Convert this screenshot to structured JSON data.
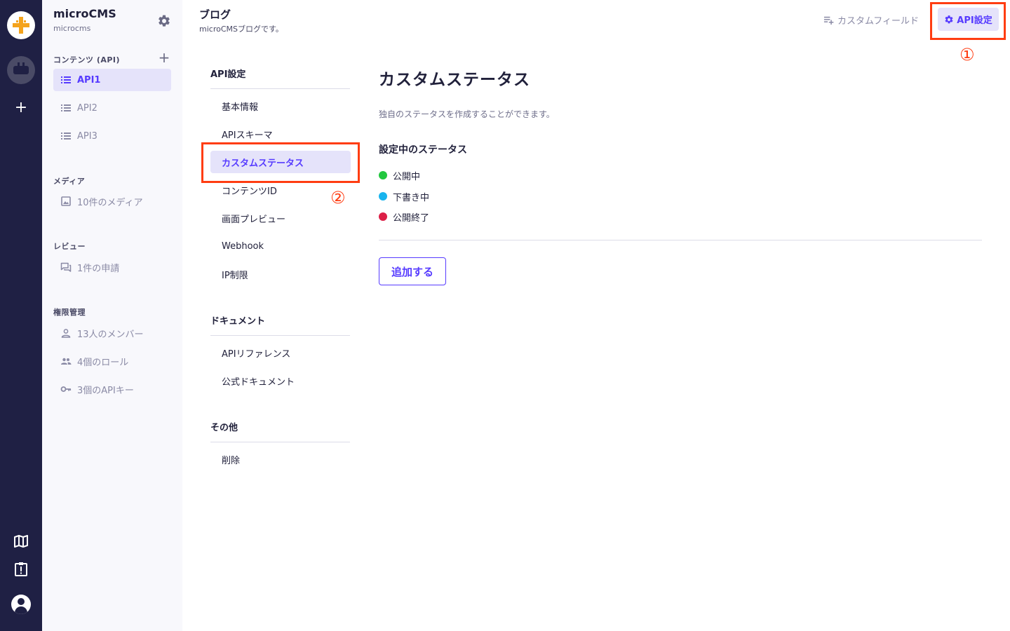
{
  "service": {
    "name": "microCMS",
    "id": "microcms"
  },
  "sidebar": {
    "contents_title": "コンテンツ (API)",
    "apis": [
      {
        "label": "API1",
        "active": true
      },
      {
        "label": "API2",
        "active": false
      },
      {
        "label": "API3",
        "active": false
      }
    ],
    "media_title": "メディア",
    "media_item": "10件のメディア",
    "review_title": "レビュー",
    "review_item": "1件の申請",
    "permission_title": "権限管理",
    "members_item": "13人のメンバー",
    "roles_item": "4個のロール",
    "apikeys_item": "3個のAPIキー"
  },
  "header": {
    "api_title": "ブログ",
    "api_description": "microCMSブログです。",
    "custom_field_label": "カスタムフィールド",
    "api_settings_label": "API設定"
  },
  "settings_menu": {
    "group_api": "API設定",
    "api_items": [
      {
        "label": "基本情報",
        "active": false
      },
      {
        "label": "APIスキーマ",
        "active": false
      },
      {
        "label": "カスタムステータス",
        "active": true
      },
      {
        "label": "コンテンツID",
        "active": false
      },
      {
        "label": "画面プレビュー",
        "active": false
      },
      {
        "label": "Webhook",
        "active": false
      },
      {
        "label": "IP制限",
        "active": false
      }
    ],
    "group_docs": "ドキュメント",
    "doc_items": [
      {
        "label": "APIリファレンス"
      },
      {
        "label": "公式ドキュメント"
      }
    ],
    "group_other": "その他",
    "other_items": [
      {
        "label": "削除"
      }
    ]
  },
  "content": {
    "title": "カスタムステータス",
    "description": "独自のステータスを作成することができます。",
    "current_title": "設定中のステータス",
    "statuses": [
      {
        "label": "公開中",
        "color": "#22c73f"
      },
      {
        "label": "下書き中",
        "color": "#18b4ee"
      },
      {
        "label": "公開終了",
        "color": "#dc2047"
      }
    ],
    "add_button": "追加する"
  },
  "annotations": {
    "marker_1": "①",
    "marker_2": "②",
    "color": "#ff3d12"
  },
  "colors": {
    "accent": "#563bff",
    "rail": "#1f2044",
    "active_bg": "#e5e3fa"
  },
  "icons": {
    "rail": [
      "microcms-logo-icon",
      "service-icon",
      "plus-icon",
      "map-icon",
      "clipboard-alert-icon",
      "account-icon"
    ],
    "sidebar": [
      "gear-icon",
      "plus-icon",
      "list-icon",
      "image-icon",
      "chat-icon",
      "person-icon",
      "people-icon",
      "key-icon"
    ],
    "header": [
      "playlist-add-icon",
      "gear-icon"
    ]
  }
}
